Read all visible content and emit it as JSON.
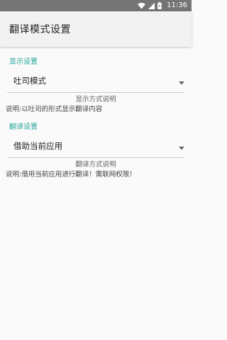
{
  "status_bar": {
    "time": "11:36",
    "icons": [
      "wifi-icon",
      "signal-icon",
      "battery-icon"
    ]
  },
  "app_bar": {
    "title": "翻译模式设置"
  },
  "sections": [
    {
      "header": "显示设置",
      "spinner_value": "吐司模式",
      "desc_title": "显示方式说明",
      "desc_text": "说明:以吐司的形式显示翻译内容"
    },
    {
      "header": "翻译设置",
      "spinner_value": "借助当前应用",
      "desc_title": "翻译方式说明",
      "desc_text": "说明:借用当前应用进行翻译！需联网权限！"
    }
  ],
  "colors": {
    "accent": "#26a69a",
    "status_bar": "#757575",
    "app_bar": "#f2f2f2",
    "background": "#fafafa"
  }
}
